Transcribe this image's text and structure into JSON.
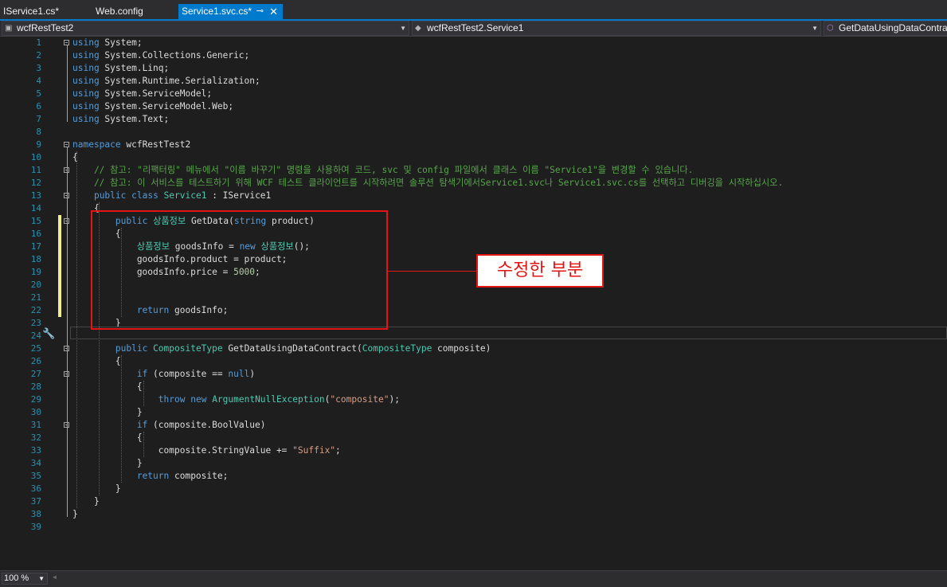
{
  "tabs": [
    {
      "label": "IService1.cs*",
      "active": false
    },
    {
      "label": "Web.config",
      "active": false
    },
    {
      "label": "Service1.svc.cs*",
      "active": true
    }
  ],
  "tab_icons": {
    "pin": "⊸",
    "close": "✕"
  },
  "navbar": {
    "project": "wcfRestTest2",
    "type": "wcfRestTest2.Service1",
    "member": "GetDataUsingDataContra"
  },
  "code_lines": [
    [
      {
        "t": "using",
        "c": "kw"
      },
      {
        "t": " System;"
      }
    ],
    [
      {
        "t": "using",
        "c": "kw"
      },
      {
        "t": " System.Collections.Generic;"
      }
    ],
    [
      {
        "t": "using",
        "c": "kw"
      },
      {
        "t": " System.Linq;"
      }
    ],
    [
      {
        "t": "using",
        "c": "kw"
      },
      {
        "t": " System.Runtime.Serialization;"
      }
    ],
    [
      {
        "t": "using",
        "c": "kw"
      },
      {
        "t": " System.ServiceModel;"
      }
    ],
    [
      {
        "t": "using",
        "c": "kw"
      },
      {
        "t": " System.ServiceModel.Web;"
      }
    ],
    [
      {
        "t": "using",
        "c": "kw"
      },
      {
        "t": " System.Text;"
      }
    ],
    [],
    [
      {
        "t": "namespace",
        "c": "kw"
      },
      {
        "t": " wcfRestTest2"
      }
    ],
    [
      {
        "t": "{"
      }
    ],
    [
      {
        "t": "    // 참고: \"리팩터링\" 메뉴에서 \"이름 바꾸기\" 명령을 사용하여 코드, svc 및 config 파일에서 클래스 이름 \"Service1\"을 변경할 수 있습니다.",
        "c": "cm"
      }
    ],
    [
      {
        "t": "    // 참고: 이 서비스를 테스트하기 위해 WCF 테스트 클라이언트를 시작하려면 솔루션 탐색기에서Service1.svc나 Service1.svc.cs를 선택하고 디버깅을 시작하십시오.",
        "c": "cm"
      }
    ],
    [
      {
        "t": "    "
      },
      {
        "t": "public",
        "c": "kw"
      },
      {
        "t": " "
      },
      {
        "t": "class",
        "c": "kw"
      },
      {
        "t": " "
      },
      {
        "t": "Service1",
        "c": "ty"
      },
      {
        "t": " : IService1"
      }
    ],
    [
      {
        "t": "    {"
      }
    ],
    [
      {
        "t": "        "
      },
      {
        "t": "public",
        "c": "kw"
      },
      {
        "t": " "
      },
      {
        "t": "상품정보",
        "c": "ty"
      },
      {
        "t": " GetData("
      },
      {
        "t": "string",
        "c": "kw"
      },
      {
        "t": " product)"
      }
    ],
    [
      {
        "t": "        {"
      }
    ],
    [
      {
        "t": "            "
      },
      {
        "t": "상품정보",
        "c": "ty"
      },
      {
        "t": " goodsInfo = "
      },
      {
        "t": "new",
        "c": "kw"
      },
      {
        "t": " "
      },
      {
        "t": "상품정보",
        "c": "ty"
      },
      {
        "t": "();"
      }
    ],
    [
      {
        "t": "            goodsInfo.product = product;"
      }
    ],
    [
      {
        "t": "            goodsInfo.price = "
      },
      {
        "t": "5000",
        "c": "nm"
      },
      {
        "t": ";"
      }
    ],
    [],
    [],
    [
      {
        "t": "            "
      },
      {
        "t": "return",
        "c": "kw"
      },
      {
        "t": " goodsInfo;"
      }
    ],
    [
      {
        "t": "        }"
      }
    ],
    [],
    [
      {
        "t": "        "
      },
      {
        "t": "public",
        "c": "kw"
      },
      {
        "t": " "
      },
      {
        "t": "CompositeType",
        "c": "ty"
      },
      {
        "t": " GetDataUsingDataContract("
      },
      {
        "t": "CompositeType",
        "c": "ty"
      },
      {
        "t": " composite)"
      }
    ],
    [
      {
        "t": "        {"
      }
    ],
    [
      {
        "t": "            "
      },
      {
        "t": "if",
        "c": "kw"
      },
      {
        "t": " (composite == "
      },
      {
        "t": "null",
        "c": "kw"
      },
      {
        "t": ")"
      }
    ],
    [
      {
        "t": "            {"
      }
    ],
    [
      {
        "t": "                "
      },
      {
        "t": "throw",
        "c": "kw"
      },
      {
        "t": " "
      },
      {
        "t": "new",
        "c": "kw"
      },
      {
        "t": " "
      },
      {
        "t": "ArgumentNullException",
        "c": "ty"
      },
      {
        "t": "("
      },
      {
        "t": "\"composite\"",
        "c": "st"
      },
      {
        "t": ");"
      }
    ],
    [
      {
        "t": "            }"
      }
    ],
    [
      {
        "t": "            "
      },
      {
        "t": "if",
        "c": "kw"
      },
      {
        "t": " (composite.BoolValue)"
      }
    ],
    [
      {
        "t": "            {"
      }
    ],
    [
      {
        "t": "                composite.StringValue += "
      },
      {
        "t": "\"Suffix\"",
        "c": "st"
      },
      {
        "t": ";"
      }
    ],
    [
      {
        "t": "            }"
      }
    ],
    [
      {
        "t": "            "
      },
      {
        "t": "return",
        "c": "kw"
      },
      {
        "t": " composite;"
      }
    ],
    [
      {
        "t": "        }"
      }
    ],
    [
      {
        "t": "    }"
      }
    ],
    [
      {
        "t": "}"
      }
    ],
    []
  ],
  "annotation_label": "수정한 부분",
  "status": {
    "zoom": "100 %"
  },
  "colors": {
    "keyword": "#569cd6",
    "type": "#4ec9b0",
    "string": "#d69d85",
    "comment": "#57a64a",
    "number": "#b5cea8",
    "line_number": "#2b91af",
    "highlight": "#e31414",
    "tab_active": "#007acc"
  }
}
